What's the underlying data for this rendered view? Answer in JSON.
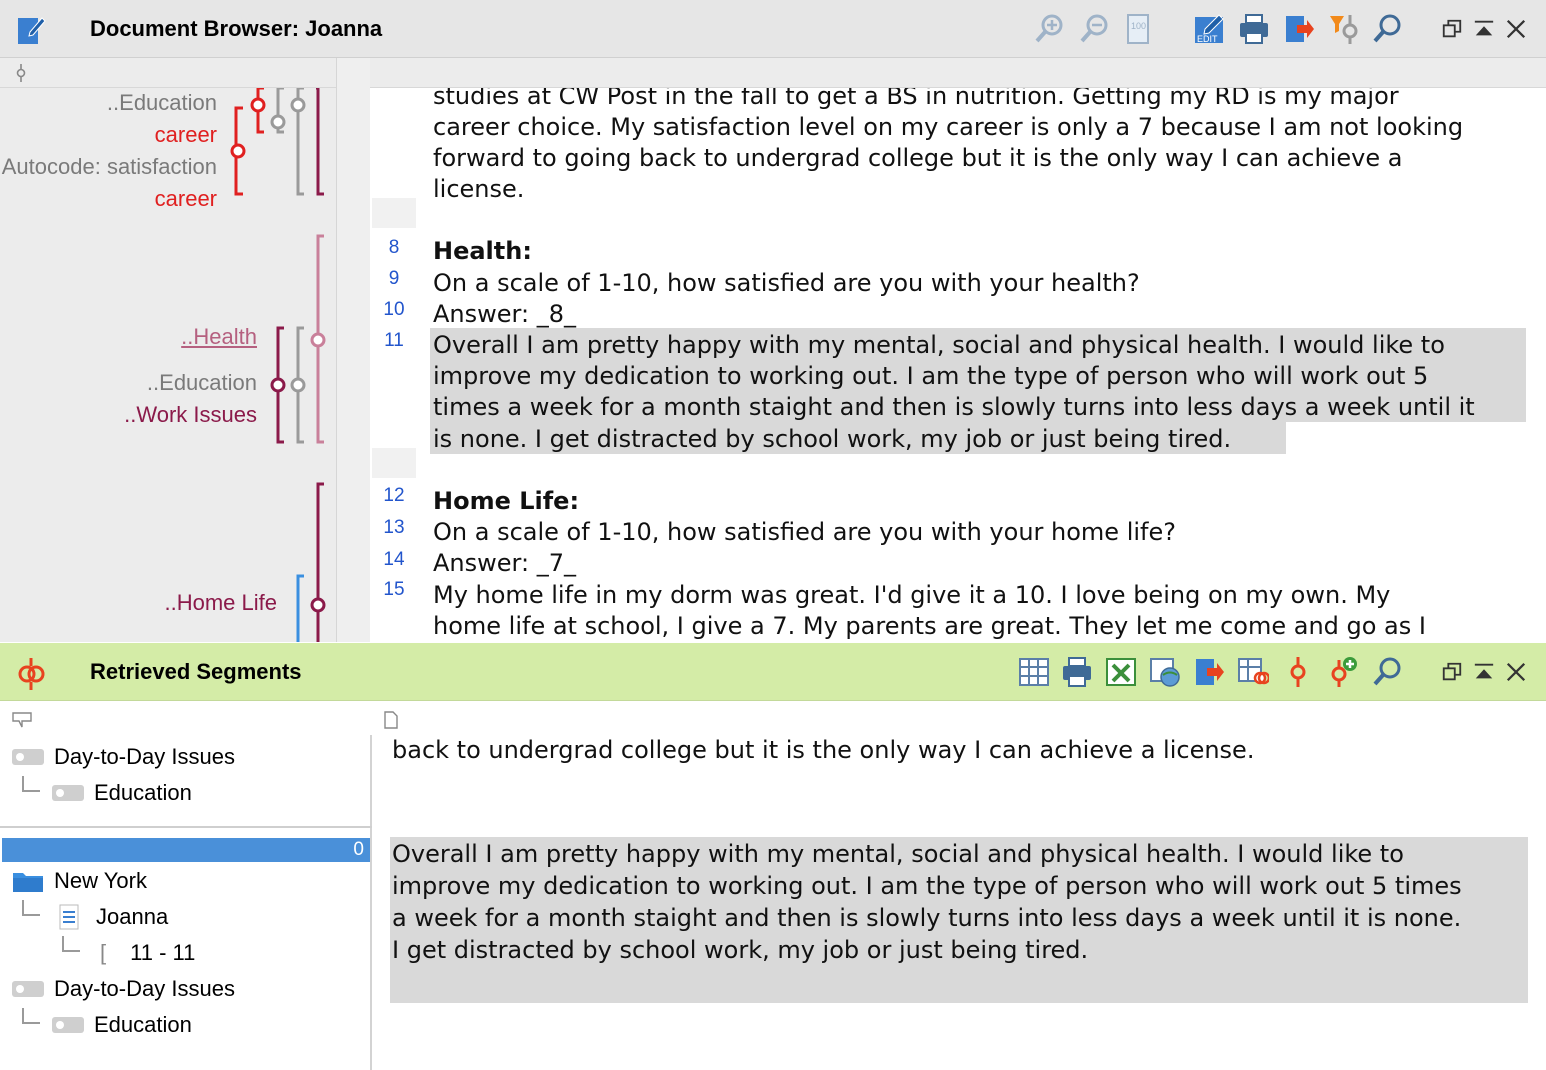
{
  "doc_browser": {
    "title": "Document Browser: Joanna",
    "toolbar_icons": [
      "zoom-in-icon",
      "zoom-out-icon",
      "font-size-icon",
      "edit-icon",
      "print-icon",
      "export-icon",
      "filter-icon",
      "search-icon"
    ],
    "window_controls": [
      "restore-icon",
      "collapse-icon",
      "close-icon"
    ],
    "code_labels": [
      {
        "text": "..Education",
        "color": "#7a7a7a"
      },
      {
        "text": "career",
        "color": "#e02020"
      },
      {
        "text": "Autocode: satisfaction",
        "color": "#7a7a7a"
      },
      {
        "text": "career",
        "color": "#e02020"
      },
      {
        "text": "..Health",
        "color": "#b5607f"
      },
      {
        "text": "..Education",
        "color": "#7a7a7a"
      },
      {
        "text": "..Work Issues",
        "color": "#8b1a4a"
      },
      {
        "text": "..Home Life",
        "color": "#8b1a4a"
      }
    ],
    "line_numbers": [
      "8",
      "9",
      "10",
      "11",
      "12",
      "13",
      "14",
      "15"
    ],
    "lines": [
      "studies at CW Post in the fall to get a BS in nutrition.  Getting my RD is my major",
      "career choice.  My satisfaction level on my career is only a 7 because I am not looking",
      "forward to going back to undergrad college but it is the only way I can achieve a",
      "license.",
      "Health:",
      "On a scale of 1-10, how satisfied are you with your health?",
      "Answer: _8_",
      "Overall I am pretty happy with my mental, social and physical health.  I would like to",
      "improve my dedication to working out.  I am the type of person who will work out 5",
      "times a week for a month staight and then is slowly turns into less days a week until it",
      "is none.  I get distracted by school work, my job or just being tired.",
      "Home Life:",
      "On a scale of 1-10, how satisfied are you with your home life?",
      "Answer: _7_",
      "My home life in my dorm was great. I'd give it a 10.  I love being on my own.  My",
      "home life at school, I give a 7.  My parents are great.  They let me come and go as I"
    ]
  },
  "retrieved": {
    "title": "Retrieved Segments",
    "toolbar_icons": [
      "table-icon",
      "print-icon",
      "excel-icon",
      "web-export-icon",
      "export-icon",
      "table-codes-icon",
      "code-icon",
      "add-code-icon",
      "search-icon"
    ],
    "tree": {
      "group1_code": "Day-to-Day Issues",
      "group1_sub": "Education",
      "counter": "0",
      "folder": "New York",
      "document": "Joanna",
      "segment": "11 - 11",
      "group2_code": "Day-to-Day Issues",
      "group2_sub": "Education"
    },
    "segment1": "back to undergrad college but it is the only way I can achieve a license.",
    "segment2": [
      "Overall I am pretty happy with my mental, social and physical health.  I would like to",
      "improve my dedication to working out.  I am the type of person who will work out 5 times",
      "a week for a month staight and then is slowly turns into less days a week until it is none.",
      "I get distracted by school work, my job or just being tired."
    ]
  }
}
